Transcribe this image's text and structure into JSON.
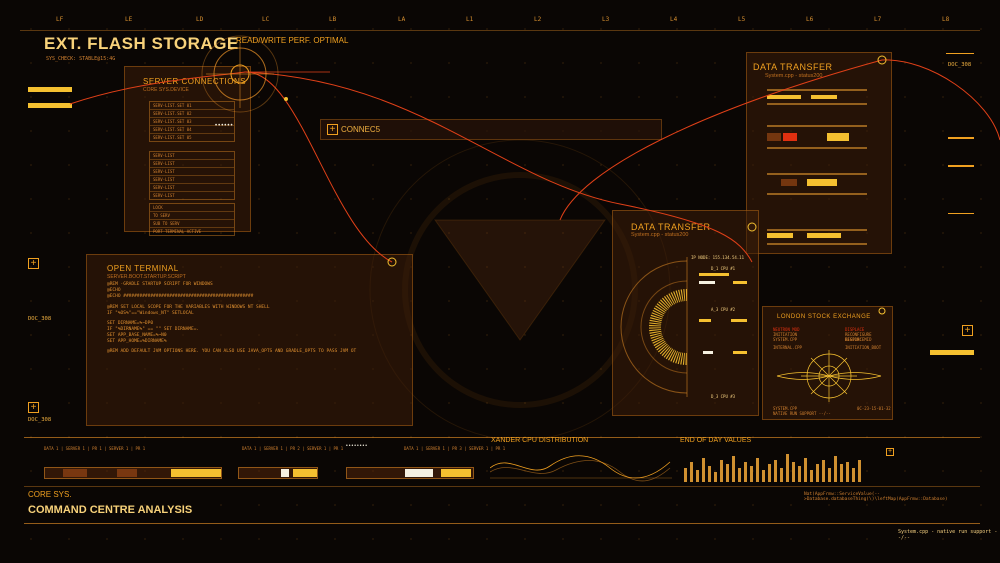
{
  "header": {
    "title": "EXT. FLASH STORAGE",
    "subtitle": "READ/WRITE PERF. OPTIMAL",
    "sys_check": "SYS_CHECK: STABLE@15:4G"
  },
  "columns": [
    "LF",
    "LE",
    "LD",
    "LC",
    "LB",
    "LA",
    "L1",
    "L2",
    "L3",
    "L4",
    "L5",
    "L6",
    "L7",
    "L8"
  ],
  "doc_labels": {
    "right_top": "DOC_308",
    "left_mid": "DOC_308",
    "left_bottom": "DOC_308"
  },
  "server_connections": {
    "title": "SERVER CONNECTIONS",
    "subtitle": "CORE SYS.DEVICE",
    "rows_a": [
      "SERV-LIST.SET 01",
      "SERV-LIST.SET 02",
      "SERV-LIST.SET 03",
      "SERV-LIST.SET 04",
      "SERV-LIST.SET 05"
    ],
    "rows_b": [
      "SERV-LIST",
      "SERV-LIST",
      "SERV-LIST",
      "SERV-LIST",
      "SERV-LIST",
      "SERV-LIST"
    ],
    "rows_c": [
      "LOCK",
      "TO SERV",
      "SUB TO SERV",
      "PORT TERMINAL ACTIVE"
    ]
  },
  "connect_bar": {
    "label": "CONNEC5"
  },
  "open_terminal": {
    "title": "OPEN TERMINAL",
    "subtitle": "SERVER.BOOT.STARTUP.SCRIPT",
    "lines": [
      "@REM ·GRADLE STARTUP SCRIPT FOR WINDOWS",
      "@ECHO",
      "@ECHO ################################################",
      "@REM SET LOCAL SCOPE FOR THE VARIABLES WITH WINDOWS NT SHELL",
      "IF \"%OS%\"==\"Windows_NT\" SETLOCAL",
      "SET DIRNAME=%~DP0",
      "IF \"%DIRNAME%\" == \"\" SET DIRNAME=.",
      "SET APP_BASE_NAME=%~N0",
      "SET APP_HOME=%DIRNAME%",
      "@REM ADD DEFAULT JVM OPTIONS HERE. YOU CAN ALSO USE JAVA_OPTS AND GRADLE_OPTS TO PASS JVM OT"
    ]
  },
  "data_transfer_top": {
    "title": "DATA TRANSFER",
    "subtitle": "System.cpp - status200"
  },
  "data_transfer_mid": {
    "title": "DATA TRANSFER",
    "subtitle": "System.cpp - status200",
    "ip": "IP NODE: 155.134.54.11",
    "cpu_labels": [
      "D_1 CPU #1",
      "A_3 CPU #2",
      "D_3 CPU #3"
    ]
  },
  "london": {
    "title": "LONDON STOCK EXCHANGE",
    "left_lines": [
      "NEUTRON MOD",
      "INITIATION",
      "SYSTEM.CPP"
    ],
    "right_lines": [
      "DISPLACE",
      "RECONFIGURE DISPLACE",
      "REGION: MID"
    ],
    "init_cpp": "INTERNAL.CPP",
    "init_boot": "INITIATION_BOOT",
    "bottom_left": "SYSTEM.CPP",
    "bottom_left2": "NATIVE RUN SUPPORT --/--",
    "bottom_right": "0C-23-15-01-32"
  },
  "bottom": {
    "server_labels": [
      "DATA 1 | SERVER 1 | PR 1 | SERVER 1 | PR 1",
      "DATA 1 | SERVER 1 | PR 2 | SERVER 1 | PR 1",
      "DATA 1 | SERVER 1 | PR 3 | SERVER 1 | PR 1"
    ],
    "xander_title": "XANDER CPU DISTRIBUTION",
    "end_of_day_title": "END OF DAY VALUES",
    "core_sys": "CORE SYS.",
    "command_centre": "COMMAND CENTRE ANALYSIS",
    "path_text": "Nat(AppFrmw::ServiceValue(-->Database.databaseThing(\\)\\leftMap(AppFrmw::Database)",
    "footer_status": "System.cpp - native run support --/--"
  },
  "colors": {
    "accent": "#f0a020",
    "bright": "#f5c030",
    "alert": "#e03010",
    "line": "#e04018"
  }
}
